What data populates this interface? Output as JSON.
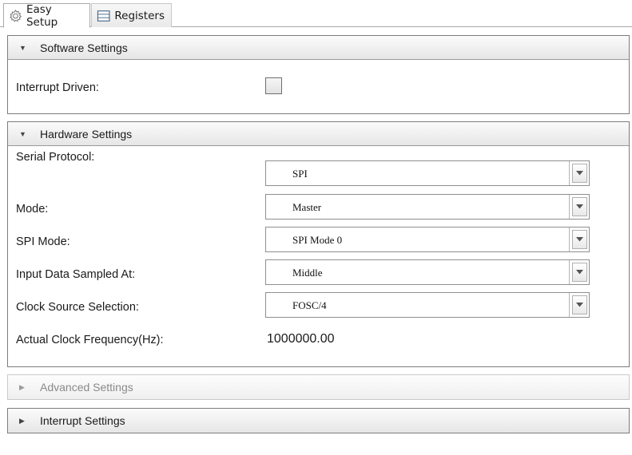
{
  "tabs": [
    {
      "label": "Easy Setup",
      "icon": "gear-icon",
      "active": true
    },
    {
      "label": "Registers",
      "icon": "registers-icon",
      "active": false
    }
  ],
  "software_settings": {
    "title": "Software Settings",
    "interrupt_driven_label": "Interrupt Driven:",
    "interrupt_driven_checked": false
  },
  "hardware_settings": {
    "title": "Hardware Settings",
    "fields": [
      {
        "label": "Serial Protocol:",
        "value": "SPI"
      },
      {
        "label": "Mode:",
        "value": "Master"
      },
      {
        "label": "SPI Mode:",
        "value": "SPI Mode 0"
      },
      {
        "label": "Input Data Sampled At:",
        "value": "Middle"
      },
      {
        "label": "Clock Source Selection:",
        "value": "FOSC/4"
      }
    ],
    "clock_freq_label": "Actual Clock Frequency(Hz):",
    "clock_freq_value": "1000000.00"
  },
  "advanced_settings": {
    "title": "Advanced Settings",
    "enabled": false
  },
  "interrupt_settings": {
    "title": "Interrupt Settings"
  },
  "icons": {
    "expanded": "triangle-down-icon",
    "collapsed": "triangle-right-icon",
    "dropdown": "chevron-down-icon"
  }
}
